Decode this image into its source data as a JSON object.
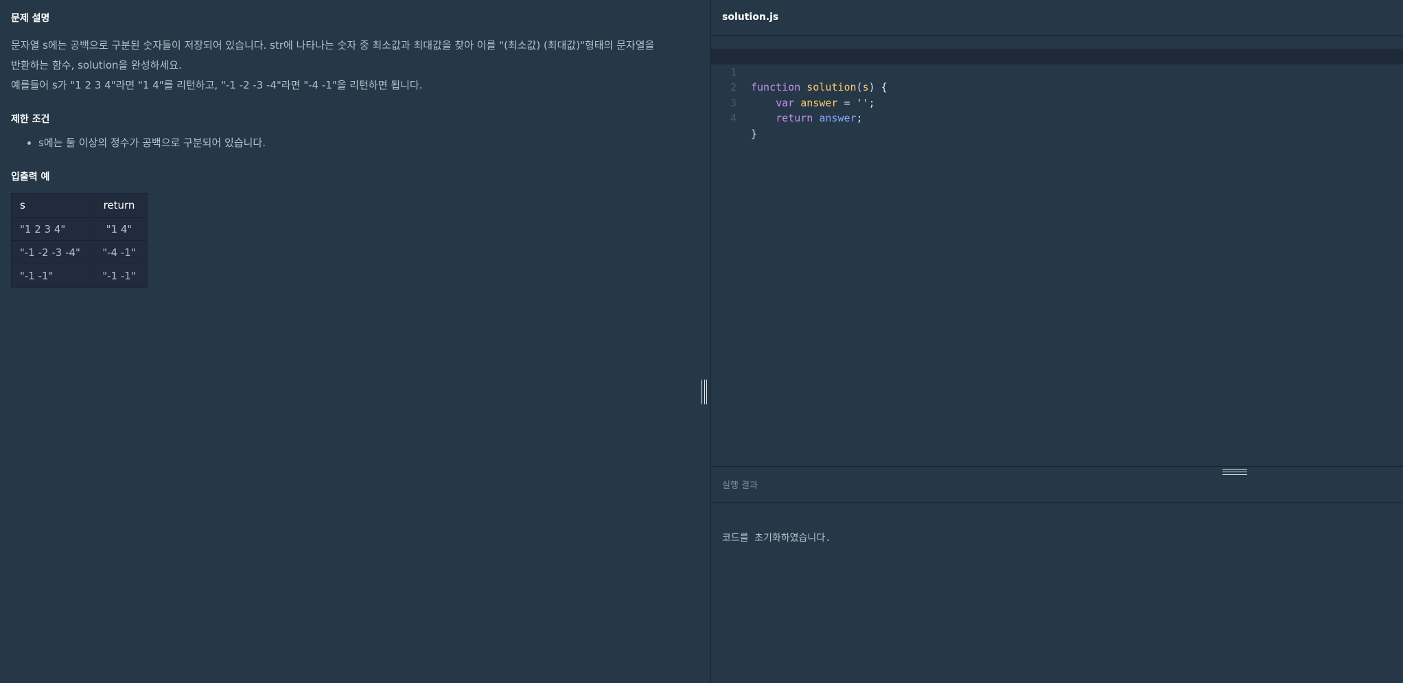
{
  "problem": {
    "title": "문제 설명",
    "description_line1": "문자열 s에는 공백으로 구분된 숫자들이 저장되어 있습니다. str에 나타나는 숫자 중 최소값과 최대값을 찾아 이를 \"(최소값) (최대값)\"형태의 문자열을",
    "description_line2": "반환하는 함수, solution을 완성하세요.",
    "description_line3": "예를들어 s가 \"1 2 3 4\"라면 \"1 4\"를 리턴하고, \"-1 -2 -3 -4\"라면 \"-4 -1\"을 리턴하면 됩니다.",
    "constraints_title": "제한 조건",
    "constraints": [
      "s에는 둘 이상의 정수가 공백으로 구분되어 있습니다."
    ],
    "examples_title": "입출력 예",
    "table": {
      "headers": [
        "s",
        "return"
      ],
      "rows": [
        [
          "\"1 2 3 4\"",
          "\"1 4\""
        ],
        [
          "\"-1 -2 -3 -4\"",
          "\"-4 -1\""
        ],
        [
          "\"-1 -1\"",
          "\"-1 -1\""
        ]
      ]
    }
  },
  "editor": {
    "file_name": "solution.js",
    "line_numbers": [
      "1",
      "2",
      "3",
      "4"
    ],
    "code": {
      "l1_kw": "function",
      "l1_fn": "solution",
      "l1_open": "(",
      "l1_param": "s",
      "l1_close": ") {",
      "l2_indent": "    ",
      "l2_kw": "var",
      "l2_var": "answer",
      "l2_eq": " = ",
      "l2_str": "''",
      "l2_end": ";",
      "l3_indent": "    ",
      "l3_kw": "return",
      "l3_var": "answer",
      "l3_end": ";",
      "l4": "}"
    }
  },
  "result": {
    "title": "실행 결과",
    "message": "코드를 초기화하였습니다."
  }
}
